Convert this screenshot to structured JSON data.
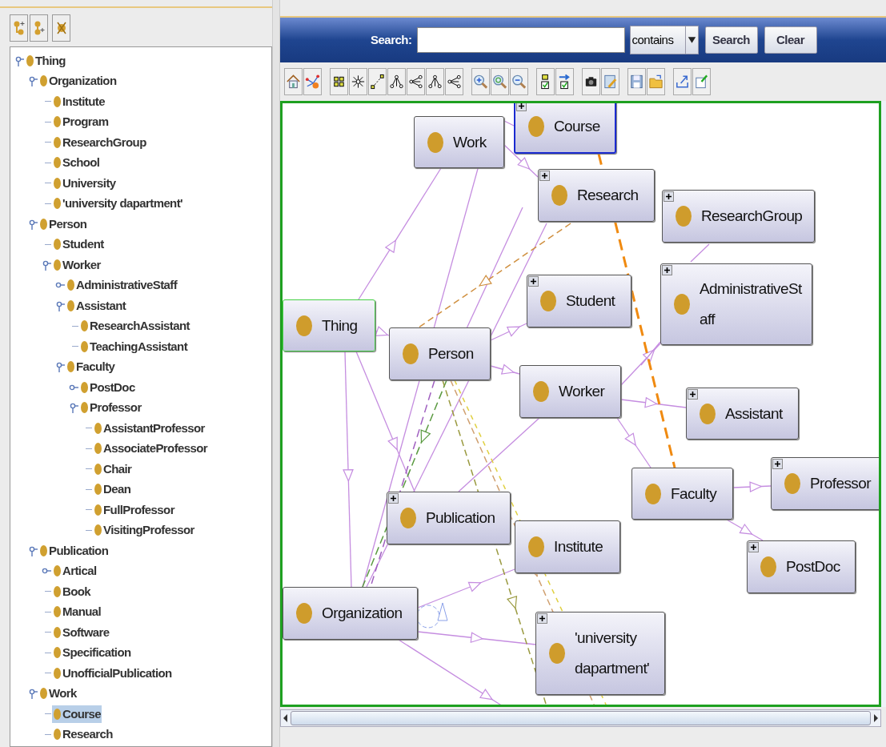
{
  "class_tree": {
    "items": [
      {
        "name": "Thing",
        "selected": false,
        "expanded": true,
        "children": [
          {
            "name": "Organization",
            "selected": false,
            "expanded": true,
            "children": [
              {
                "name": "Institute",
                "selected": false
              },
              {
                "name": "Program",
                "selected": false
              },
              {
                "name": "ResearchGroup",
                "selected": false
              },
              {
                "name": "School",
                "selected": false
              },
              {
                "name": "University",
                "selected": false
              },
              {
                "name": "'university dapartment'",
                "selected": false
              }
            ]
          },
          {
            "name": "Person",
            "selected": false,
            "expanded": true,
            "children": [
              {
                "name": "Student",
                "selected": false
              },
              {
                "name": "Worker",
                "selected": false,
                "expanded": true,
                "children": [
                  {
                    "name": "AdministrativeStaff",
                    "selected": false,
                    "expanded": false
                  },
                  {
                    "name": "Assistant",
                    "selected": false,
                    "expanded": true,
                    "children": [
                      {
                        "name": "ResearchAssistant",
                        "selected": false
                      },
                      {
                        "name": "TeachingAssistant",
                        "selected": false
                      }
                    ]
                  },
                  {
                    "name": "Faculty",
                    "selected": false,
                    "expanded": true,
                    "children": [
                      {
                        "name": "PostDoc",
                        "selected": false,
                        "expanded": false
                      },
                      {
                        "name": "Professor",
                        "selected": false,
                        "expanded": true,
                        "children": [
                          {
                            "name": "AssistantProfessor",
                            "selected": false
                          },
                          {
                            "name": "AssociateProfessor",
                            "selected": false
                          },
                          {
                            "name": "Chair",
                            "selected": false
                          },
                          {
                            "name": "Dean",
                            "selected": false
                          },
                          {
                            "name": "FullProfessor",
                            "selected": false
                          },
                          {
                            "name": "VisitingProfessor",
                            "selected": false
                          }
                        ]
                      }
                    ]
                  }
                ]
              }
            ]
          },
          {
            "name": "Publication",
            "selected": false,
            "expanded": true,
            "children": [
              {
                "name": "Artical",
                "selected": false,
                "expanded": false
              },
              {
                "name": "Book",
                "selected": false
              },
              {
                "name": "Manual",
                "selected": false
              },
              {
                "name": "Software",
                "selected": false
              },
              {
                "name": "Specification",
                "selected": false
              },
              {
                "name": "UnofficialPublication",
                "selected": false
              }
            ]
          },
          {
            "name": "Work",
            "selected": false,
            "expanded": true,
            "children": [
              {
                "name": "Course",
                "selected": true
              },
              {
                "name": "Research",
                "selected": false
              }
            ]
          }
        ]
      }
    ]
  },
  "search_bar": {
    "label": "Search:",
    "mode": "contains",
    "buttons": [
      "Search",
      "Clear"
    ]
  },
  "graph": {
    "nodes": [
      {
        "name": "Work",
        "selected": false,
        "focused": false,
        "collapsed": false
      },
      {
        "name": "Course",
        "selected": true,
        "focused": false,
        "collapsed": true
      },
      {
        "name": "Research",
        "selected": false,
        "focused": false,
        "collapsed": true
      },
      {
        "name": "ResearchGroup",
        "selected": false,
        "focused": false,
        "collapsed": true
      },
      {
        "name": "Student",
        "selected": false,
        "focused": false,
        "collapsed": true
      },
      {
        "name": "AdministrativeStaff",
        "selected": false,
        "focused": false,
        "collapsed": true
      },
      {
        "name": "Thing",
        "selected": false,
        "focused": true,
        "collapsed": false
      },
      {
        "name": "Person",
        "selected": false,
        "focused": false,
        "collapsed": false
      },
      {
        "name": "Worker",
        "selected": false,
        "focused": false,
        "collapsed": false
      },
      {
        "name": "Assistant",
        "selected": false,
        "focused": false,
        "collapsed": true
      },
      {
        "name": "Faculty",
        "selected": false,
        "focused": false,
        "collapsed": false
      },
      {
        "name": "Professor",
        "selected": false,
        "focused": false,
        "collapsed": true
      },
      {
        "name": "Publication",
        "selected": false,
        "focused": false,
        "collapsed": true
      },
      {
        "name": "Institute",
        "selected": false,
        "focused": false,
        "collapsed": false
      },
      {
        "name": "PostDoc",
        "selected": false,
        "focused": false,
        "collapsed": true
      },
      {
        "name": "Organization",
        "selected": false,
        "focused": false,
        "collapsed": false
      },
      {
        "name": "'university dapartment'",
        "selected": false,
        "focused": false,
        "collapsed": true
      }
    ]
  }
}
